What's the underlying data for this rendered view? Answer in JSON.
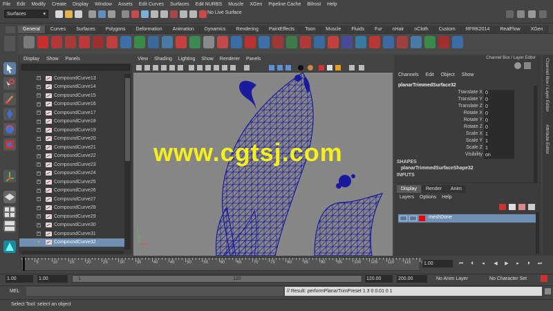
{
  "menubar": [
    "File",
    "Edit",
    "Modify",
    "Create",
    "Display",
    "Window",
    "Assets",
    "Edit Curves",
    "Surfaces",
    "Edit NURBS",
    "Muscle",
    "XGen",
    "Pipeline Cache",
    "Bifrost",
    "Help"
  ],
  "statusline": {
    "mode": "Surfaces",
    "live": "No Live Surface"
  },
  "shelf_tabs": [
    "General",
    "Curves",
    "Surfaces",
    "Polygons",
    "Deformation",
    "Animation",
    "Dynamics",
    "Rendering",
    "PaintEffects",
    "Toon",
    "Muscle",
    "Fluids",
    "Fur",
    "nHair",
    "nCloth",
    "Custom",
    "RFRK2014",
    "RealFlow",
    "XGen"
  ],
  "outliner": {
    "menu": [
      "Display",
      "Show",
      "Panels"
    ],
    "items": [
      "CompoundCurve13",
      "CompoundCurve14",
      "CompoundCurve15",
      "CompoundCurve16",
      "CompoundCurve17",
      "CompoundCurve18",
      "CompoundCurve19",
      "CompoundCurve20",
      "CompoundCurve21",
      "CompoundCurve22",
      "CompoundCurve23",
      "CompoundCurve24",
      "CompoundCurve25",
      "CompoundCurve26",
      "CompoundCurve27",
      "CompoundCurve28",
      "CompoundCurve29",
      "CompoundCurve30",
      "CompoundCurve31",
      "CompoundCurve32"
    ],
    "selected_index": 19
  },
  "viewport": {
    "menu": [
      "View",
      "Shading",
      "Lighting",
      "Show",
      "Renderer",
      "Panels"
    ],
    "watermark": "www.cgtsj.com",
    "mesh_color": "#1a1a9e"
  },
  "channel_box": {
    "title": "Channel Box / Layer Editor",
    "menu": [
      "Channels",
      "Edit",
      "Object",
      "Show"
    ],
    "object_name": "planarTrimmedSurface32",
    "attributes": [
      {
        "label": "Translate X",
        "value": "0"
      },
      {
        "label": "Translate Y",
        "value": "0"
      },
      {
        "label": "Translate Z",
        "value": "0"
      },
      {
        "label": "Rotate X",
        "value": "0"
      },
      {
        "label": "Rotate Y",
        "value": "0"
      },
      {
        "label": "Rotate Z",
        "value": "0"
      },
      {
        "label": "Scale X",
        "value": "1"
      },
      {
        "label": "Scale Y",
        "value": "1"
      },
      {
        "label": "Scale Z",
        "value": "1"
      },
      {
        "label": "Visibility",
        "value": "on"
      }
    ],
    "shapes_header": "SHAPES",
    "shape_name": "planarTrimmedSurfaceShape32",
    "inputs_header": "INPUTS"
  },
  "layer_editor": {
    "tabs": [
      "Display",
      "Render",
      "Anim"
    ],
    "menu": [
      "Layers",
      "Options",
      "Help"
    ],
    "layer_name": "meshDone"
  },
  "side_tabs": [
    "Channel Box / Layer Editor",
    "Attribute Editor"
  ],
  "timeline": {
    "ticks": [
      "5",
      "10",
      "15",
      "20",
      "25",
      "30",
      "35",
      "40",
      "45",
      "50",
      "55",
      "60",
      "65",
      "70",
      "75",
      "80",
      "85",
      "90",
      "95",
      "100",
      "105",
      "110",
      "115",
      "120"
    ],
    "current_frame": "1.00"
  },
  "range": {
    "start": "1.00",
    "playback_start": "1.00",
    "slider_left": "1",
    "slider_right": "120",
    "playback_end": "120.00",
    "end": "200.00",
    "anim_layer": "No Anim Layer",
    "character_set": "No Character Set"
  },
  "command_line": {
    "label": "MEL",
    "result": "// Result: performPlanarTrimPreset 1 3 0 0.01 0 1"
  },
  "help_line": "Select Tool: select an object"
}
